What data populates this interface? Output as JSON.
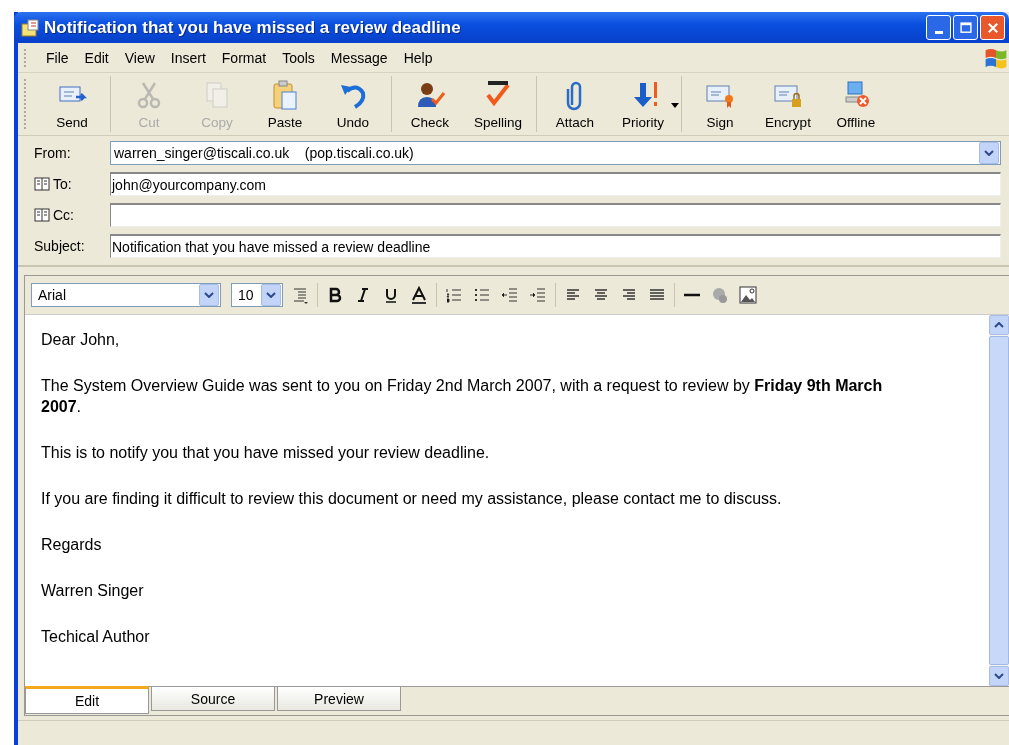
{
  "window": {
    "title": "Notification that you have missed a review deadline"
  },
  "menu": [
    {
      "label": "File"
    },
    {
      "label": "Edit"
    },
    {
      "label": "View"
    },
    {
      "label": "Insert"
    },
    {
      "label": "Format"
    },
    {
      "label": "Tools"
    },
    {
      "label": "Message"
    },
    {
      "label": "Help"
    }
  ],
  "toolbar": [
    {
      "buttons": [
        {
          "kind": "send",
          "label": "Send",
          "disabled": false
        }
      ]
    },
    {
      "buttons": [
        {
          "kind": "cut",
          "label": "Cut",
          "disabled": true
        },
        {
          "kind": "copy",
          "label": "Copy",
          "disabled": true
        },
        {
          "kind": "paste",
          "label": "Paste",
          "disabled": false
        },
        {
          "kind": "undo",
          "label": "Undo",
          "disabled": false
        }
      ]
    },
    {
      "buttons": [
        {
          "kind": "check",
          "label": "Check",
          "disabled": false
        },
        {
          "kind": "spelling",
          "label": "Spelling",
          "disabled": false
        }
      ]
    },
    {
      "buttons": [
        {
          "kind": "attach",
          "label": "Attach",
          "disabled": false
        },
        {
          "kind": "priority",
          "label": "Priority",
          "disabled": false,
          "dropdown": true
        }
      ]
    },
    {
      "buttons": [
        {
          "kind": "sign",
          "label": "Sign",
          "disabled": false
        },
        {
          "kind": "encrypt",
          "label": "Encrypt",
          "disabled": false
        },
        {
          "kind": "offline",
          "label": "Offline",
          "disabled": false
        }
      ]
    }
  ],
  "header_fields": [
    {
      "kind": "dropdown",
      "label": "From:",
      "value": "warren_singer@tiscali.co.uk    (pop.tiscali.co.uk)"
    },
    {
      "kind": "address",
      "label": "To:",
      "value": "john@yourcompany.com"
    },
    {
      "kind": "address",
      "label": "Cc:"
    },
    {
      "kind": "text",
      "label": "Subject:",
      "value": "Notification that you have missed a review deadline"
    }
  ],
  "format_toolbar": {
    "font": "Arial",
    "size": "10"
  },
  "body": {
    "paragraphs": [
      "Dear John,",
      "The System Overview Guide was sent to you on Friday 2nd March 2007, with a request to review by **Friday 9th March 2007**.",
      "This is to notify you that you have missed your review deadline.",
      "If you are finding it difficult to review this document or need my assistance, please contact me to discuss.",
      "Regards",
      "Warren Singer",
      "Techical Author"
    ]
  },
  "tabs": [
    {
      "label": "Edit",
      "selected": true
    },
    {
      "label": "Source",
      "selected": false
    },
    {
      "label": "Preview",
      "selected": false
    }
  ]
}
